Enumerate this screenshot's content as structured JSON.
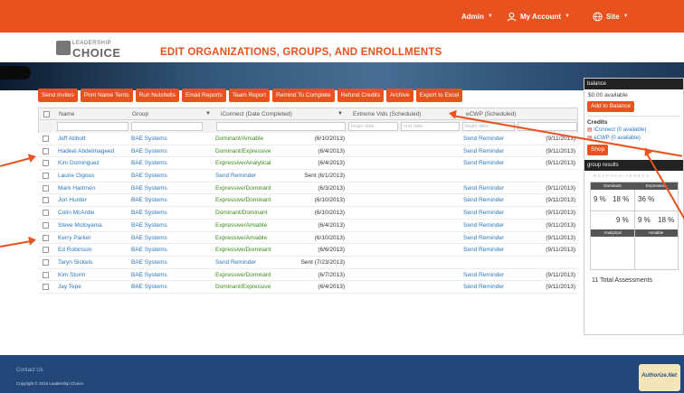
{
  "topbar": {
    "admin": "Admin",
    "account": "My Account",
    "site": "Site"
  },
  "header": {
    "logo_top": "LEADERSHIP",
    "logo_bottom": "CHOICE",
    "title": "EDIT ORGANIZATIONS, GROUPS, AND ENROLLMENTS"
  },
  "toolbar": [
    "Send Invites",
    "Print Name Tents",
    "Run Nutshells",
    "Email Reports",
    "Team Report",
    "Remind To Complete",
    "Refund Credits",
    "Archive",
    "Export to Excel"
  ],
  "columns": {
    "name": "Name",
    "group": "Group",
    "iconnect": "iConnect (Date Completed)",
    "vids": "Extreme Vids (Scheduled)",
    "ecwp": "eCWP (Scheduled)"
  },
  "filters": {
    "begin": "begin date",
    "end": "end date"
  },
  "rows": [
    {
      "name": "Jeff Abbott",
      "group": "BAE Systems",
      "iconnect": "Dominant/Amiable",
      "date": "(6/10/2013)",
      "ecwp": "Send Reminder",
      "ecwp_date": "(9/11/2013)"
    },
    {
      "name": "Hadeel Abdelmageed",
      "group": "BAE Systems",
      "iconnect": "Dominant/Expressive",
      "date": "(6/4/2013)",
      "ecwp": "Send Reminder",
      "ecwp_date": "(9/11/2013)"
    },
    {
      "name": "Kim Dominguez",
      "group": "BAE Systems",
      "iconnect": "Expressive/Analytical",
      "date": "(6/4/2013)",
      "ecwp": "Send Reminder",
      "ecwp_date": "(9/11/2013)"
    },
    {
      "name": "Laurie Gigous",
      "group": "BAE Systems",
      "iconnect": "Send Reminder",
      "date": "Sent (6/1/2013)",
      "ecwp": "",
      "ecwp_date": ""
    },
    {
      "name": "Mark Hartmen",
      "group": "BAE Systems",
      "iconnect": "Expressive/Dominant",
      "date": "(6/3/2013)",
      "ecwp": "Send Reminder",
      "ecwp_date": "(9/11/2013)"
    },
    {
      "name": "Jon Hunter",
      "group": "BAE Systems",
      "iconnect": "Expressive/Dominant",
      "date": "(6/10/2013)",
      "ecwp": "Send Reminder",
      "ecwp_date": "(9/11/2013)"
    },
    {
      "name": "Colin McArdle",
      "group": "BAE Systems",
      "iconnect": "Dominant/Dominant",
      "date": "(6/10/2013)",
      "ecwp": "Send Reminder",
      "ecwp_date": "(9/11/2013)"
    },
    {
      "name": "Steve Motoyama",
      "group": "BAE Systems",
      "iconnect": "Expressive/Amiable",
      "date": "(6/4/2013)",
      "ecwp": "Send Reminder",
      "ecwp_date": "(9/11/2013)"
    },
    {
      "name": "Kerry Parker",
      "group": "BAE Systems",
      "iconnect": "Expressive/Amiable",
      "date": "(6/10/2013)",
      "ecwp": "Send Reminder",
      "ecwp_date": "(9/11/2013)"
    },
    {
      "name": "Ed Robinson",
      "group": "BAE Systems",
      "iconnect": "Expressive/Dominant",
      "date": "(6/6/2013)",
      "ecwp": "Send Reminder",
      "ecwp_date": "(9/11/2013)"
    },
    {
      "name": "Taryn Sickels",
      "group": "BAE Systems",
      "iconnect": "Send Reminder",
      "date": "Sent (7/23/2013)",
      "ecwp": "",
      "ecwp_date": ""
    },
    {
      "name": "Kim Sturm",
      "group": "BAE Systems",
      "iconnect": "Expressive/Dominant",
      "date": "(6/7/2013)",
      "ecwp": "Send Reminder",
      "ecwp_date": "(9/11/2013)"
    },
    {
      "name": "Jay Tepe",
      "group": "BAE Systems",
      "iconnect": "Dominant/Expressive",
      "date": "(6/4/2013)",
      "ecwp": "Send Reminder",
      "ecwp_date": "(9/11/2013)"
    }
  ],
  "sidebar": {
    "balance_header": "balance",
    "balance_value": "$0.00 available",
    "add_balance": "Add to Balance",
    "credits_label": "Credits",
    "credit_iconnect": "iConnect (0 available)",
    "credit_ecwp": "eCWP (0 available)",
    "shop": "Shop",
    "group_results_header": "group results",
    "axis_top": "RESPONSIVENESS",
    "quad_labels": {
      "dominant": "Dominant",
      "expressive": "Expressive",
      "analytical": "Analytical",
      "amiable": "Amiable"
    },
    "pct": {
      "a": "9 %",
      "b": "18 %",
      "c": "36 %",
      "d": "9 %",
      "e": "9 %",
      "f": "18 %"
    },
    "total": "11 Total Assessments"
  },
  "footer": {
    "contact": "Contact Us",
    "copyright": "Copyright © 2016 Leadership Choice."
  },
  "authnet": "Authorize.Net"
}
